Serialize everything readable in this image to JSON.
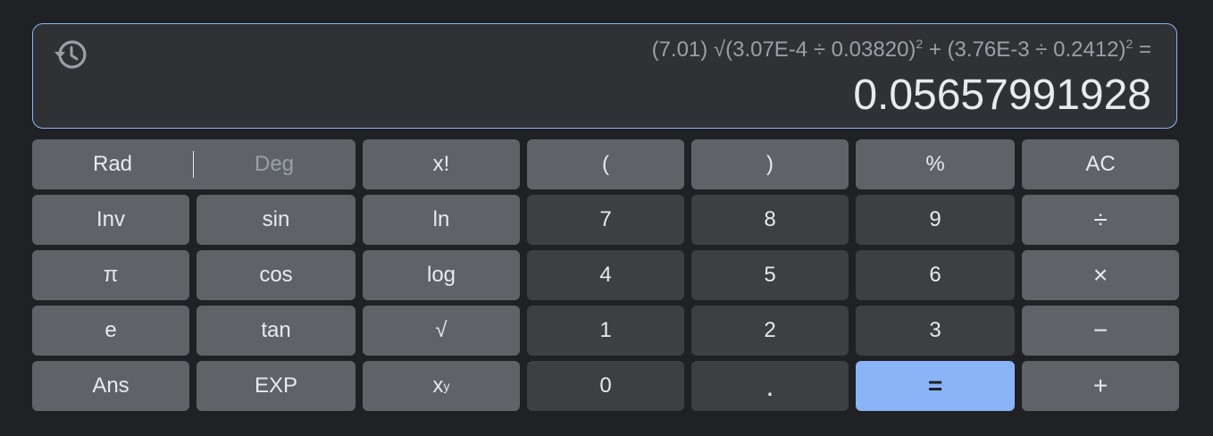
{
  "display": {
    "expr_lead": "(7.01) √(3.07E-4 ÷ 0.03820)",
    "exp1": "2",
    "expr_mid": " + (3.76E-3 ÷ 0.2412)",
    "exp2": "2",
    "expr_tail": " =",
    "result": "0.05657991928",
    "history_icon": "history-icon"
  },
  "mode": {
    "rad": "Rad",
    "deg": "Deg",
    "active": "Rad"
  },
  "keys": {
    "factorial": "x!",
    "lparen": "(",
    "rparen": ")",
    "percent": "%",
    "ac": "AC",
    "inv": "Inv",
    "sin": "sin",
    "ln": "ln",
    "seven": "7",
    "eight": "8",
    "nine": "9",
    "divide": "÷",
    "pi": "π",
    "cos": "cos",
    "log": "log",
    "four": "4",
    "five": "5",
    "six": "6",
    "multiply": "×",
    "e": "e",
    "tan": "tan",
    "sqrt": "√",
    "one": "1",
    "two": "2",
    "three": "3",
    "minus": "−",
    "ans": "Ans",
    "exp": "EXP",
    "pow_base": "x",
    "pow_exp": "y",
    "zero": "0",
    "dot": ".",
    "equals": "=",
    "plus": "+"
  },
  "colors": {
    "background": "#202124",
    "display_bg": "#303134",
    "display_border": "#8ab4f8",
    "function_key": "#5f6368",
    "number_key": "#3c4043",
    "equals_key": "#8ab4f8"
  }
}
